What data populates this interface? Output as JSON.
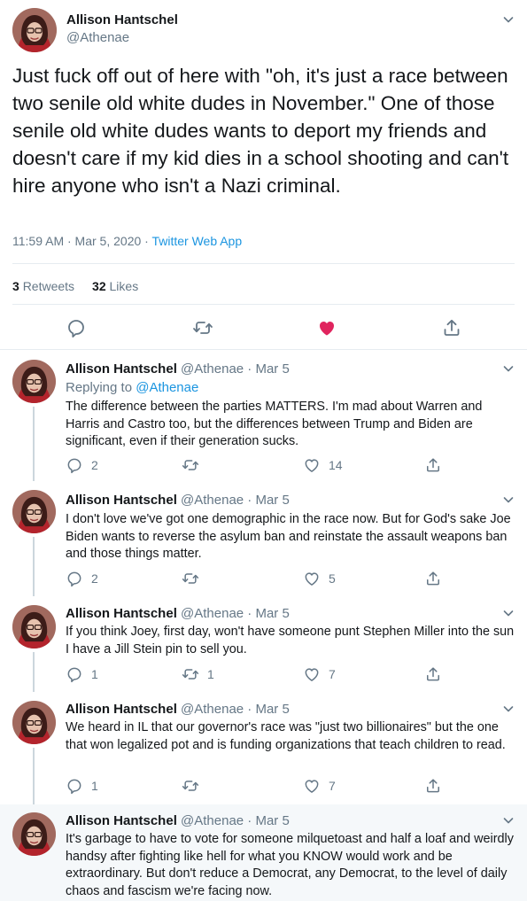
{
  "main_tweet": {
    "author_name": "Allison Hantschel",
    "handle": "@Athenae",
    "text": "Just fuck off out of here with \"oh, it's just a race between two senile old white dudes in November.\" One of those senile old white dudes wants to deport my friends and doesn't care if my kid dies in a school shooting and can't hire anyone who isn't a Nazi criminal.",
    "timestamp": "11:59 AM · Mar 5, 2020 · ",
    "source": "Twitter Web App",
    "retweets_count": "3",
    "retweets_label": "Retweets",
    "likes_count": "32",
    "likes_label": "Likes",
    "liked": true,
    "like_color": "#e0245e"
  },
  "replies": [
    {
      "author_name": "Allison Hantschel",
      "meta": "@Athenae · Mar 5",
      "replying_label": "Replying to ",
      "replying_to": "@Athenae",
      "text": "The difference between the parties MATTERS. I'm mad about Warren and Harris and Castro too, but the differences between Trump and Biden are significant, even if their generation sucks.",
      "reply_count": "2",
      "retweet_count": "",
      "like_count": "14"
    },
    {
      "author_name": "Allison Hantschel",
      "meta": "@Athenae · Mar 5",
      "text": "I don't love we've got one demographic in the race now. But for God's sake Joe Biden wants to reverse the asylum ban and reinstate the assault weapons ban and those things matter.",
      "reply_count": "2",
      "retweet_count": "",
      "like_count": "5"
    },
    {
      "author_name": "Allison Hantschel",
      "meta": "@Athenae · Mar 5",
      "text": "If you think Joey, first day, won't have someone punt Stephen Miller into the sun I have a Jill Stein pin to sell you.",
      "reply_count": "1",
      "retweet_count": "1",
      "like_count": "7"
    },
    {
      "author_name": "Allison Hantschel",
      "meta": "@Athenae · Mar 5",
      "text": "We heard in IL that our governor's race was \"just two billionaires\" but the one that won legalized pot and is funding organizations that teach children to read.",
      "reply_count": "1",
      "retweet_count": "",
      "like_count": "7"
    },
    {
      "author_name": "Allison Hantschel",
      "meta": "@Athenae · Mar 5",
      "text": "It's garbage to have to vote for someone milquetoast and half a loaf and weirdly handsy after fighting like hell for what you KNOW would work and be extraordinary. But don't reduce a Democrat, any Democrat, to the level of daily chaos and fascism we're facing now."
    }
  ],
  "icons": {
    "reply": "speech-bubble-icon",
    "retweet": "retweet-arrows-icon",
    "like": "heart-icon",
    "share": "share-upload-icon",
    "menu": "chevron-down-icon"
  },
  "colors": {
    "link": "#1b95e0",
    "muted": "#657786",
    "thread_line": "#ccd6dd",
    "highlight_bg": "#f5f8fa"
  }
}
